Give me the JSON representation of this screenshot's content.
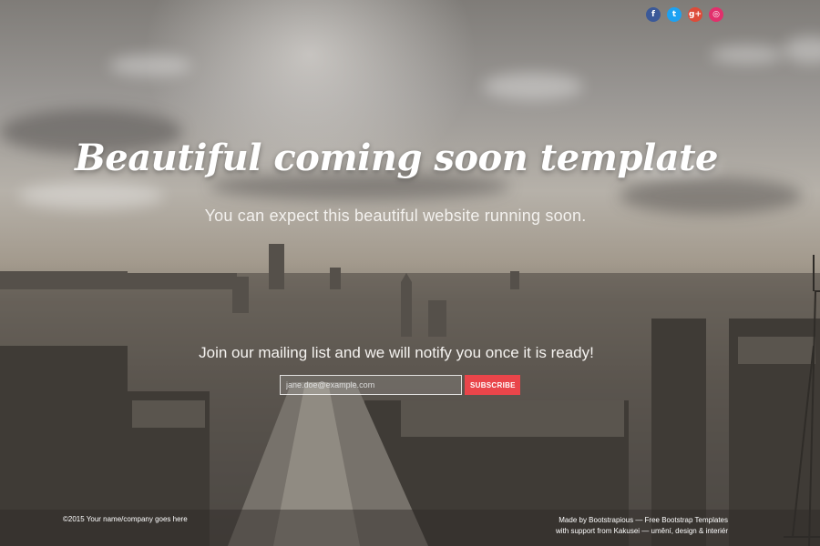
{
  "social": {
    "items": [
      {
        "name": "facebook",
        "glyph": "f",
        "color": "#3b5998"
      },
      {
        "name": "twitter",
        "glyph": "t",
        "color": "#1da1f2"
      },
      {
        "name": "google-plus",
        "glyph": "g+",
        "color": "#dd4b39"
      },
      {
        "name": "instagram",
        "glyph": "◎",
        "color": "#e1306c"
      }
    ]
  },
  "hero": {
    "title": "Beautiful coming soon template",
    "subtitle": "You can expect this beautiful website running soon."
  },
  "newsletter": {
    "heading": "Join our mailing list and we will notify you once it is ready!",
    "email_placeholder": "jane.doe@example.com",
    "subscribe_label": "SUBSCRIBE",
    "button_color": "#e9454a"
  },
  "footer": {
    "copyright": "©2015 Your name/company goes here",
    "credit_line1": "Made by Bootstrapious — Free Bootstrap Templates",
    "credit_line2": "with support from Kakusei — umění, design & interiér"
  }
}
